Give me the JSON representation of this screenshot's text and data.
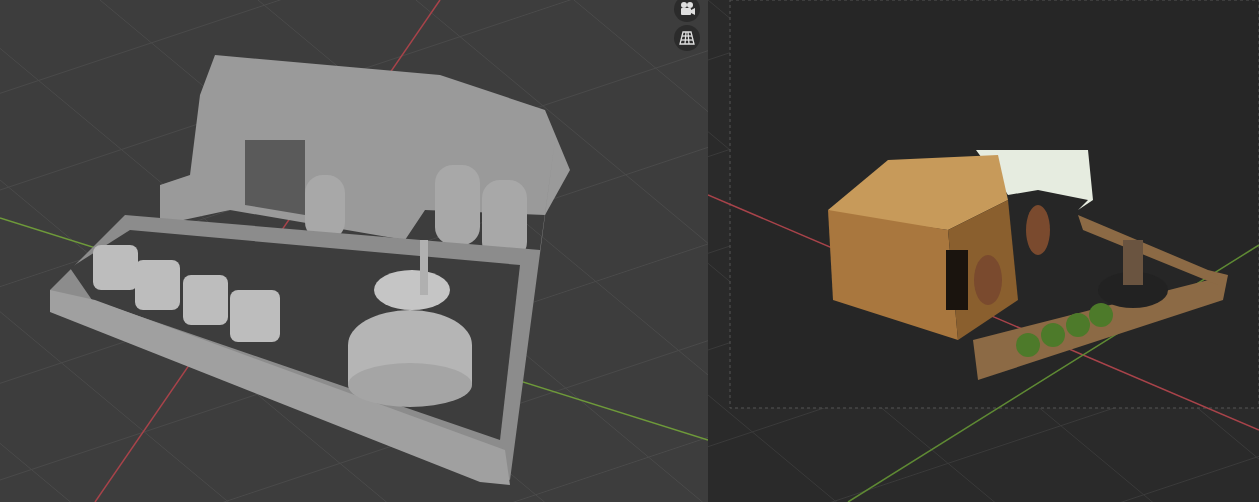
{
  "viewports": [
    {
      "kind": "solid"
    },
    {
      "kind": "rendered"
    }
  ]
}
